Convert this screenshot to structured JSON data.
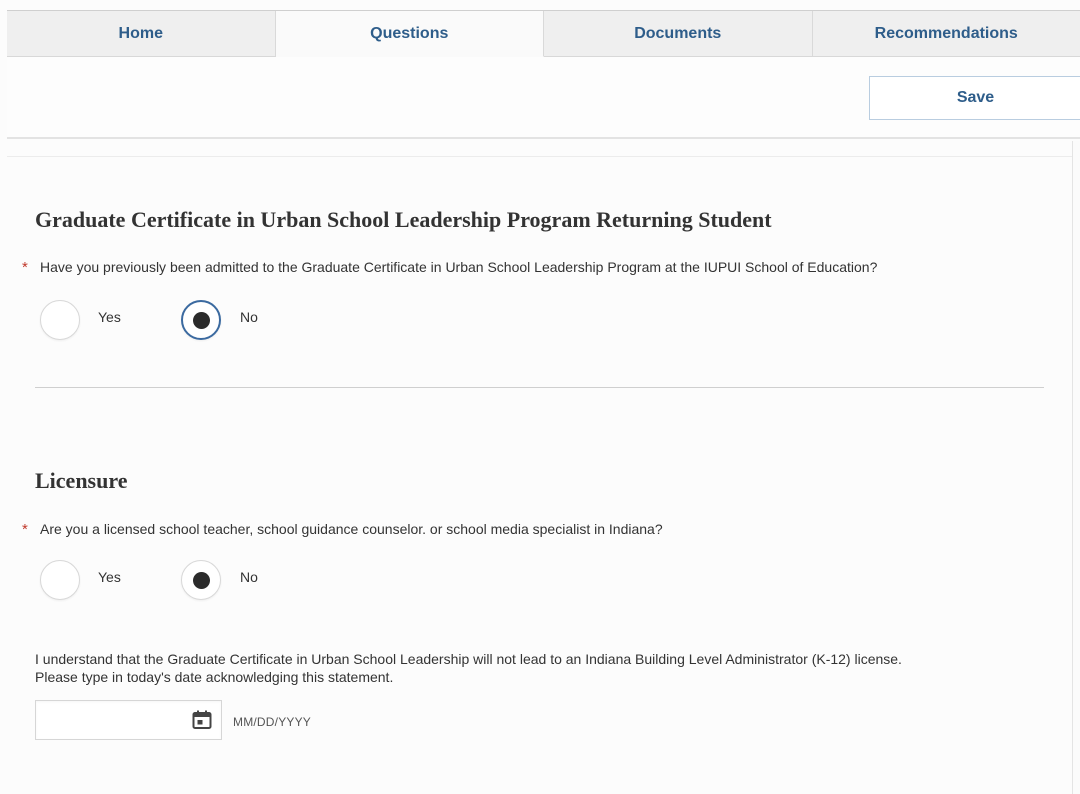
{
  "tabs": [
    {
      "label": "Home"
    },
    {
      "label": "Questions"
    },
    {
      "label": "Documents"
    },
    {
      "label": "Recommendations"
    }
  ],
  "toolbar": {
    "save_label": "Save"
  },
  "sections": [
    {
      "title": "Graduate Certificate in Urban School Leadership Program Returning Student",
      "question": "Have you previously been admitted to the Graduate Certificate in Urban School Leadership Program at the IUPUI School of Education?",
      "required_mark": "*",
      "options": [
        {
          "label": "Yes"
        },
        {
          "label": "No"
        }
      ],
      "selected": "No"
    },
    {
      "title": "Licensure",
      "question": "Are you a licensed school teacher, school guidance counselor. or school media specialist in Indiana?",
      "required_mark": "*",
      "options": [
        {
          "label": "Yes"
        },
        {
          "label": "No"
        }
      ],
      "selected": "No"
    }
  ],
  "acknowledgement": {
    "line1": "I understand that the Graduate Certificate in Urban School Leadership will not lead to an Indiana Building Level Administrator (K-12) license.",
    "line2": "Please type in today's date acknowledging this statement.",
    "date_value": "",
    "date_format_hint": "MM/DD/YYYY",
    "icon": "calendar-icon"
  },
  "colors": {
    "accent": "#2e5d8a",
    "required": "#c0392b",
    "focus": "#3b6aa0"
  }
}
